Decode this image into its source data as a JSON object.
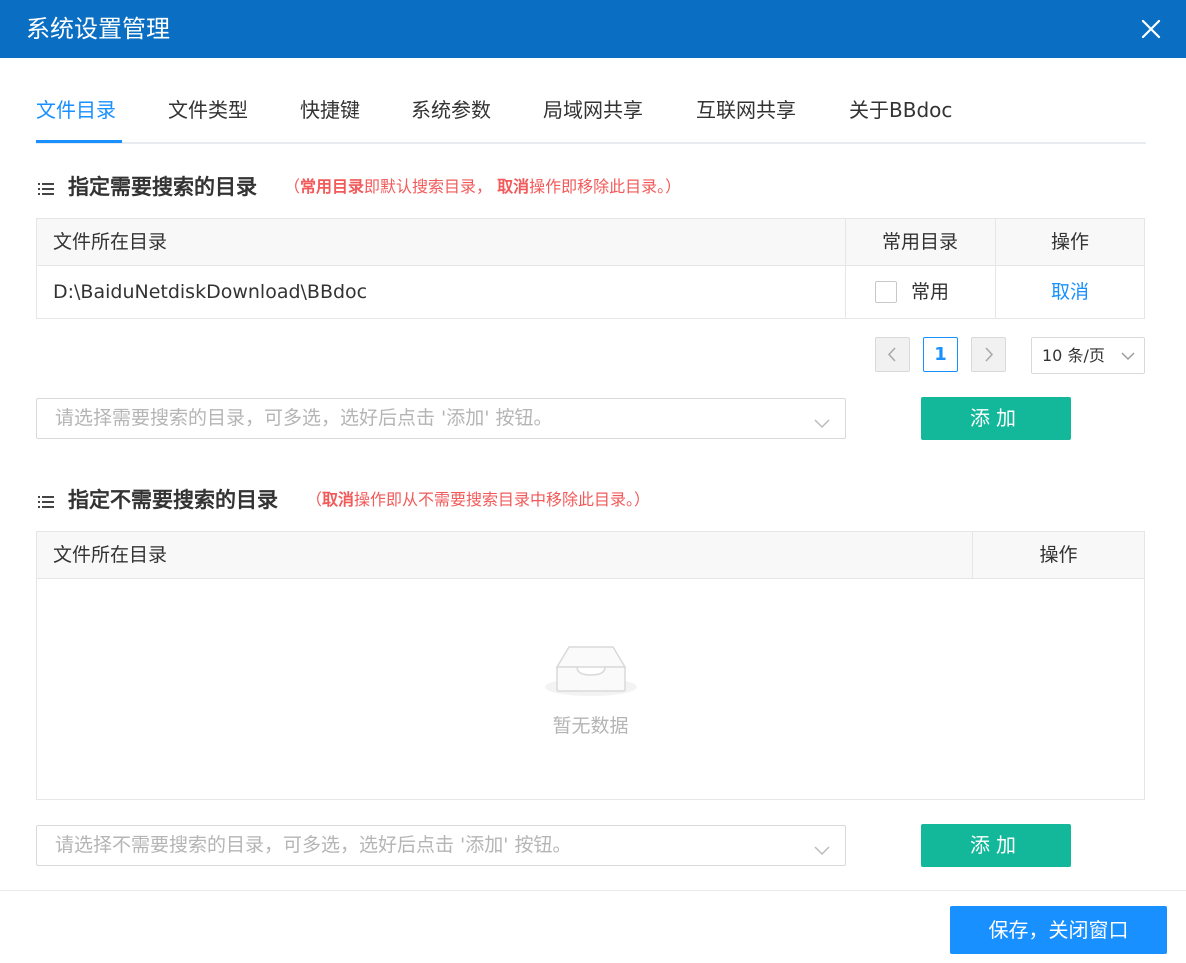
{
  "window": {
    "title": "系统设置管理"
  },
  "tabs": [
    {
      "label": "文件目录"
    },
    {
      "label": "文件类型"
    },
    {
      "label": "快捷键"
    },
    {
      "label": "系统参数"
    },
    {
      "label": "局域网共享"
    },
    {
      "label": "互联网共享"
    },
    {
      "label": "关于BBdoc"
    }
  ],
  "include_section": {
    "title": "指定需要搜索的目录",
    "note_open": "（",
    "note_bold1": "常用目录",
    "note_text1": "即默认搜索目录，",
    "note_bold2": "取消",
    "note_text2": "操作即移除此目录。）",
    "columns": {
      "path": "文件所在目录",
      "common": "常用目录",
      "action": "操作"
    },
    "rows": [
      {
        "path": "D:\\BaiduNetdiskDownload\\BBdoc",
        "common_label": "常用",
        "action_label": "取消"
      }
    ],
    "pager": {
      "current_page": "1",
      "page_size": "10 条/页"
    },
    "picker_placeholder": "请选择需要搜索的目录，可多选，选好后点击 '添加' 按钮。",
    "add_label": "添加"
  },
  "exclude_section": {
    "title": "指定不需要搜索的目录",
    "note_open": "（",
    "note_bold1": "取消",
    "note_text1": "操作即从不需要搜索目录中移除此目录。）",
    "columns": {
      "path": "文件所在目录",
      "action": "操作"
    },
    "empty_text": "暂无数据",
    "picker_placeholder": "请选择不需要搜索的目录，可多选，选好后点击 '添加' 按钮。",
    "add_label": "添加"
  },
  "footer": {
    "save_label": "保存，关闭窗口"
  },
  "colors": {
    "titlebar": "#0a6fc2",
    "accent": "#1890ff",
    "add_button": "#13b89a",
    "note": "#f25a5a"
  }
}
